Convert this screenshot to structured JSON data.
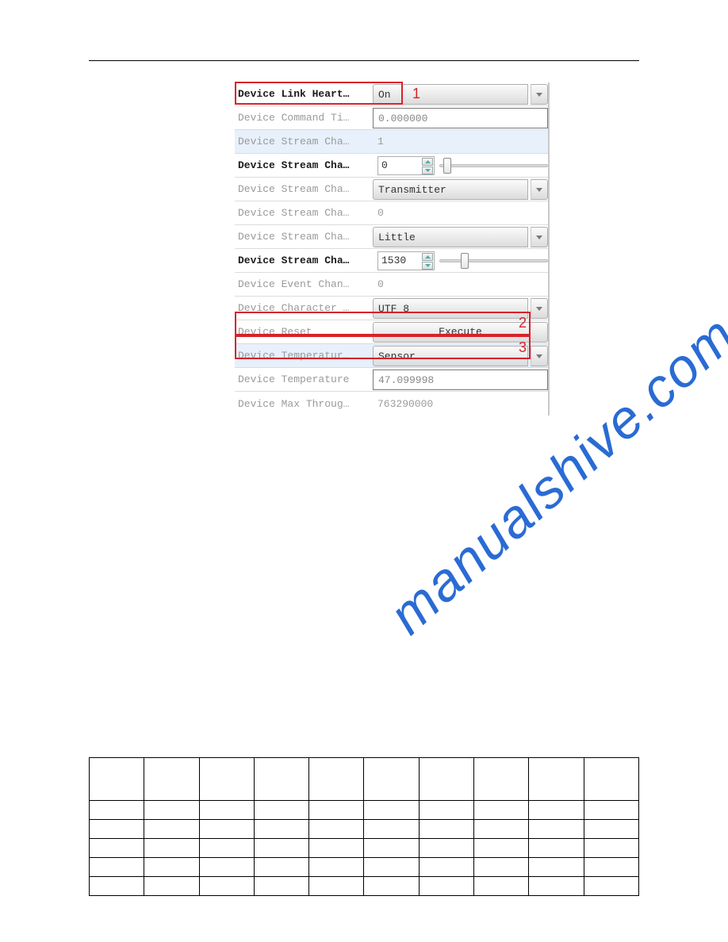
{
  "hr": true,
  "panel": {
    "rows": [
      {
        "label": "Device Link Heart…",
        "bold": true,
        "type": "dropdown",
        "value": "On"
      },
      {
        "label": "Device Command Ti…",
        "bold": false,
        "type": "textbox",
        "value": "0.000000"
      },
      {
        "label": "Device Stream Cha…",
        "bold": false,
        "type": "plain_hl",
        "value": "1"
      },
      {
        "label": "Device Stream Cha…",
        "bold": true,
        "type": "spinner_slider",
        "value": "0",
        "thumb_pct": 4
      },
      {
        "label": "Device Stream Cha…",
        "bold": false,
        "type": "dropdown",
        "value": "Transmitter"
      },
      {
        "label": "Device Stream Cha…",
        "bold": false,
        "type": "plain",
        "value": "0"
      },
      {
        "label": "Device Stream Cha…",
        "bold": false,
        "type": "dropdown",
        "value": "Little"
      },
      {
        "label": "Device Stream Cha…",
        "bold": true,
        "type": "spinner_slider",
        "value": "1530",
        "thumb_pct": 20
      },
      {
        "label": "Device Event Chan…",
        "bold": false,
        "type": "plain",
        "value": "0"
      },
      {
        "label": "Device Character …",
        "bold": false,
        "type": "dropdown",
        "value": "UTF 8"
      },
      {
        "label": "Device Reset",
        "bold": false,
        "type": "button",
        "value": "Execute"
      },
      {
        "label": "Device Temperatur…",
        "bold": false,
        "type": "dropdown_hl",
        "value": "Sensor"
      },
      {
        "label": "Device Temperature",
        "bold": false,
        "type": "textbox",
        "value": "47.099998"
      },
      {
        "label": "Device Max Throug…",
        "bold": false,
        "type": "plain",
        "value": "763290000"
      }
    ]
  },
  "annotations": {
    "n1": "1",
    "n2": "2",
    "n3": "3"
  },
  "watermark": "manualshive.com",
  "table": {
    "rows": 6,
    "cols": 10
  }
}
